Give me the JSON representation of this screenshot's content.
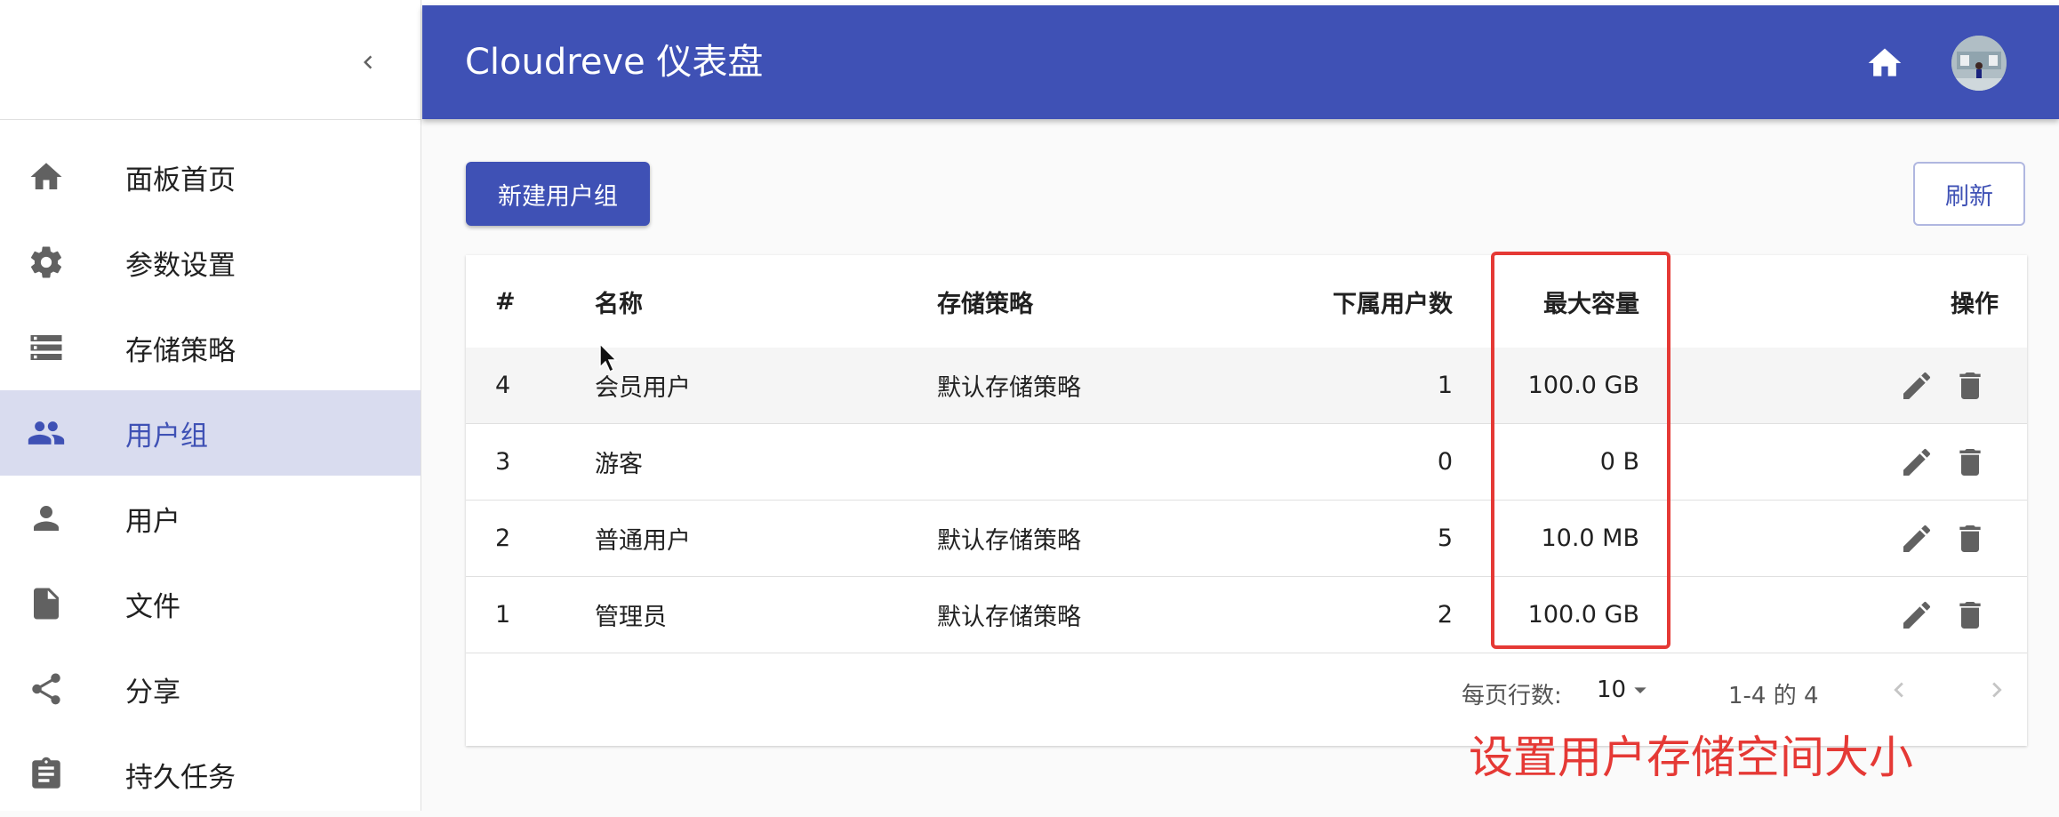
{
  "app": {
    "title": "Cloudreve 仪表盘"
  },
  "colors": {
    "primary": "#3f51b5",
    "active_bg": "#d9dcef",
    "annotation": "#e53935"
  },
  "sidebar": {
    "collapse_icon": "chevron-left-icon",
    "items": [
      {
        "label": "面板首页",
        "icon": "home-icon"
      },
      {
        "label": "参数设置",
        "icon": "gear-icon"
      },
      {
        "label": "存储策略",
        "icon": "storage-icon"
      },
      {
        "label": "用户组",
        "icon": "group-icon",
        "active": true
      },
      {
        "label": "用户",
        "icon": "person-icon"
      },
      {
        "label": "文件",
        "icon": "file-icon"
      },
      {
        "label": "分享",
        "icon": "share-icon"
      },
      {
        "label": "持久任务",
        "icon": "clipboard-icon"
      }
    ]
  },
  "toolbar": {
    "new_label": "新建用户组",
    "refresh_label": "刷新"
  },
  "table": {
    "headers": {
      "id": "#",
      "name": "名称",
      "policy": "存储策略",
      "users": "下属用户数",
      "capacity": "最大容量",
      "ops": "操作"
    },
    "rows": [
      {
        "id": "4",
        "name": "会员用户",
        "policy": "默认存储策略",
        "users": "1",
        "capacity": "100.0 GB"
      },
      {
        "id": "3",
        "name": "游客",
        "policy": "",
        "users": "0",
        "capacity": "0 B"
      },
      {
        "id": "2",
        "name": "普通用户",
        "policy": "默认存储策略",
        "users": "5",
        "capacity": "10.0 MB"
      },
      {
        "id": "1",
        "name": "管理员",
        "policy": "默认存储策略",
        "users": "2",
        "capacity": "100.0 GB"
      }
    ]
  },
  "pagination": {
    "rows_per_page_label": "每页行数:",
    "rows_per_page": "10",
    "range_label": "1-4 的 4"
  },
  "annotation": {
    "text": "设置用户存储空间大小"
  }
}
